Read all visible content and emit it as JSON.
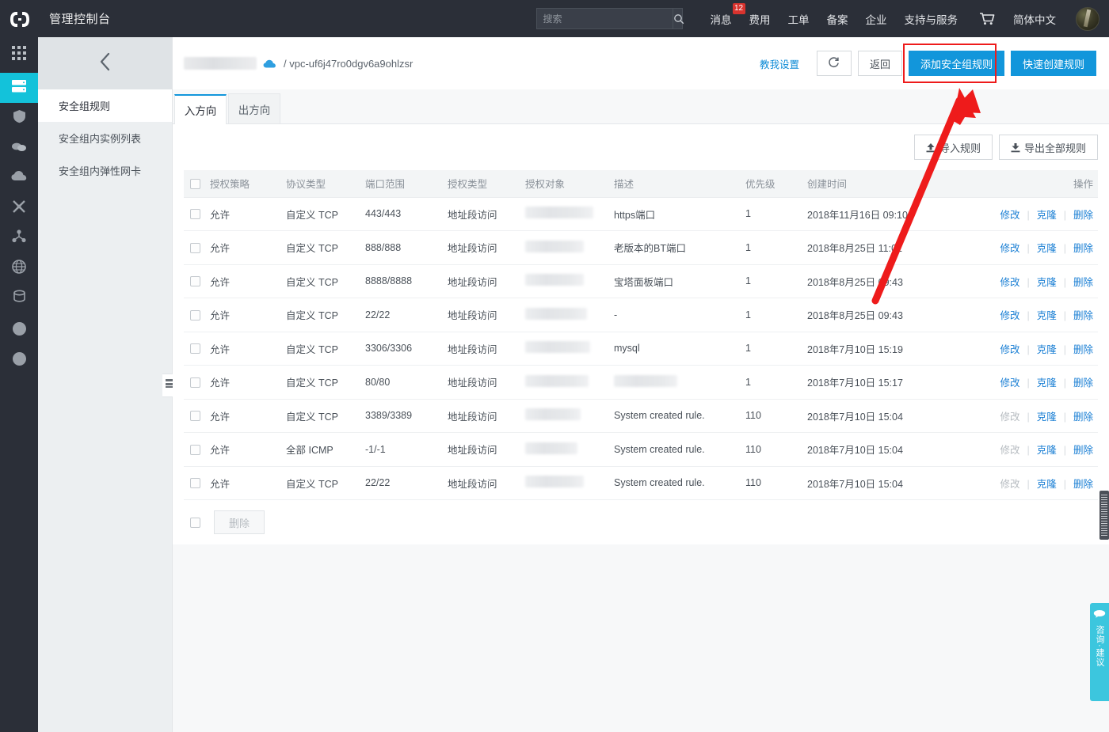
{
  "topbar": {
    "logo_icon": "brackets-logo-icon",
    "title": "管理控制台",
    "search": {
      "placeholder": "搜索",
      "value": "",
      "icon": "search-icon"
    },
    "nav": [
      {
        "label": "消息",
        "badge": "12"
      },
      {
        "label": "费用",
        "badge": ""
      },
      {
        "label": "工单",
        "badge": ""
      },
      {
        "label": "备案",
        "badge": ""
      },
      {
        "label": "企业",
        "badge": ""
      },
      {
        "label": "支持与服务",
        "badge": ""
      }
    ],
    "cart_icon": "shopping-cart-icon",
    "language": "简体中文",
    "avatar": "user-avatar"
  },
  "rail": {
    "items": [
      {
        "icon": "grid-apps-icon",
        "active": false
      },
      {
        "icon": "server-icon",
        "active": true
      },
      {
        "icon": "shield-icon",
        "active": false
      },
      {
        "icon": "cloud-stack-icon",
        "active": false
      },
      {
        "icon": "cloud-icon",
        "active": false
      },
      {
        "icon": "network-cross-icon",
        "active": false
      },
      {
        "icon": "hub-nodes-icon",
        "active": false
      },
      {
        "icon": "globe-icon",
        "active": false
      },
      {
        "icon": "database-icon",
        "active": false
      },
      {
        "icon": "circle-icon",
        "active": false
      },
      {
        "icon": "circle-icon",
        "active": false
      }
    ]
  },
  "sidebar": {
    "collapse_icon": "chevron-left-icon",
    "items": [
      {
        "label": "安全组规则",
        "active": true
      },
      {
        "label": "安全组内实例列表",
        "active": false
      },
      {
        "label": "安全组内弹性网卡",
        "active": false
      }
    ],
    "handle_icon": "collapse-handle-icon"
  },
  "breadcrumb": {
    "redacted_name": "",
    "cloud_icon": "cloud-icon",
    "separator": "/",
    "resource_id": "vpc-uf6j47ro0dgv6a9ohlzsr"
  },
  "actions": {
    "teach_me": "教我设置",
    "refresh_icon": "refresh-icon",
    "back": "返回",
    "add_rule": "添加安全组规则",
    "quick_create": "快速创建规则",
    "import_rules": "导入规则",
    "export_rules": "导出全部规则",
    "import_icon": "upload-icon",
    "export_icon": "download-icon"
  },
  "tabs": [
    {
      "label": "入方向",
      "active": true
    },
    {
      "label": "出方向",
      "active": false
    }
  ],
  "table": {
    "columns": [
      "授权策略",
      "协议类型",
      "端口范围",
      "授权类型",
      "授权对象",
      "描述",
      "优先级",
      "创建时间",
      "操作"
    ],
    "ops": {
      "edit": "修改",
      "clone": "克隆",
      "delete": "删除"
    },
    "rows": [
      {
        "policy": "允许",
        "protocol": "自定义 TCP",
        "port": "443/443",
        "auth_type": "地址段访问",
        "auth_object": "",
        "desc": "https端口",
        "desc_redacted": false,
        "priority": "1",
        "created": "2018年11月16日 09:10",
        "edit_disabled": false
      },
      {
        "policy": "允许",
        "protocol": "自定义 TCP",
        "port": "888/888",
        "auth_type": "地址段访问",
        "auth_object": "",
        "desc": "老版本的BT端口",
        "desc_redacted": false,
        "priority": "1",
        "created": "2018年8月25日 11:01",
        "edit_disabled": false
      },
      {
        "policy": "允许",
        "protocol": "自定义 TCP",
        "port": "8888/8888",
        "auth_type": "地址段访问",
        "auth_object": "",
        "desc": "宝塔面板端口",
        "desc_redacted": false,
        "priority": "1",
        "created": "2018年8月25日 09:43",
        "edit_disabled": false
      },
      {
        "policy": "允许",
        "protocol": "自定义 TCP",
        "port": "22/22",
        "auth_type": "地址段访问",
        "auth_object": "",
        "desc": "-",
        "desc_redacted": false,
        "priority": "1",
        "created": "2018年8月25日 09:43",
        "edit_disabled": false
      },
      {
        "policy": "允许",
        "protocol": "自定义 TCP",
        "port": "3306/3306",
        "auth_type": "地址段访问",
        "auth_object": "",
        "desc": "mysql",
        "desc_redacted": false,
        "priority": "1",
        "created": "2018年7月10日 15:19",
        "edit_disabled": false
      },
      {
        "policy": "允许",
        "protocol": "自定义 TCP",
        "port": "80/80",
        "auth_type": "地址段访问",
        "auth_object": "",
        "desc": "",
        "desc_redacted": true,
        "priority": "1",
        "created": "2018年7月10日 15:17",
        "edit_disabled": false
      },
      {
        "policy": "允许",
        "protocol": "自定义 TCP",
        "port": "3389/3389",
        "auth_type": "地址段访问",
        "auth_object": "",
        "desc": "System created rule.",
        "desc_redacted": false,
        "priority": "110",
        "created": "2018年7月10日 15:04",
        "edit_disabled": true
      },
      {
        "policy": "允许",
        "protocol": "全部 ICMP",
        "port": "-1/-1",
        "auth_type": "地址段访问",
        "auth_object": "",
        "desc": "System created rule.",
        "desc_redacted": false,
        "priority": "110",
        "created": "2018年7月10日 15:04",
        "edit_disabled": true
      },
      {
        "policy": "允许",
        "protocol": "自定义 TCP",
        "port": "22/22",
        "auth_type": "地址段访问",
        "auth_object": "",
        "desc": "System created rule.",
        "desc_redacted": false,
        "priority": "110",
        "created": "2018年7月10日 15:04",
        "edit_disabled": true
      }
    ],
    "footer": {
      "delete_label": "删除"
    }
  },
  "widgets": {
    "consult_icon": "chat-bubble-icon",
    "consult_text": "咨询·建议",
    "scrollbar": "vertical-scrollbar-thumb"
  },
  "colors": {
    "accent_blue": "#1296db",
    "rail_active": "#13c2da",
    "annotation_red": "#ee1b1b",
    "topbar_bg": "#2b2f38",
    "link_blue": "#1a7fd4"
  }
}
